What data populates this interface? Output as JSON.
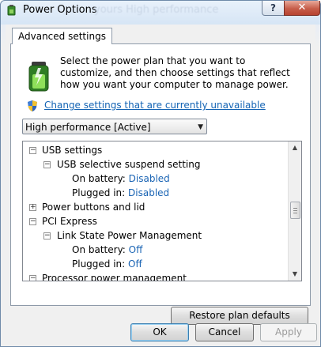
{
  "window": {
    "title": "Power Options",
    "background_title": "yours High performance",
    "help_label": "?",
    "close_label": "✕"
  },
  "tab": {
    "label": "Advanced settings"
  },
  "description": "Select the power plan that you want to customize, and then choose settings that reflect how you want your computer to manage power.",
  "change_link": "Change settings that are currently unavailable",
  "plan_select": {
    "value": "High performance [Active]"
  },
  "tree": {
    "usb_settings": "USB settings",
    "usb_selective": "USB selective suspend setting",
    "usb_on_battery_label": "On battery:",
    "usb_on_battery_value": "Disabled",
    "usb_plugged_label": "Plugged in:",
    "usb_plugged_value": "Disabled",
    "power_buttons": "Power buttons and lid",
    "pci_express": "PCI Express",
    "link_state": "Link State Power Management",
    "pci_on_battery_label": "On battery:",
    "pci_on_battery_value": "Off",
    "pci_plugged_label": "Plugged in:",
    "pci_plugged_value": "Off",
    "processor": "Processor power management"
  },
  "buttons": {
    "restore": "Restore plan defaults",
    "ok": "OK",
    "cancel": "Cancel",
    "apply": "Apply"
  },
  "icons": {
    "title": "power-options-icon",
    "battery": "battery-plug-icon",
    "shield": "uac-shield-icon"
  },
  "colors": {
    "link": "#1464b4",
    "value": "#1a64b4",
    "close": "#c75e4a"
  }
}
